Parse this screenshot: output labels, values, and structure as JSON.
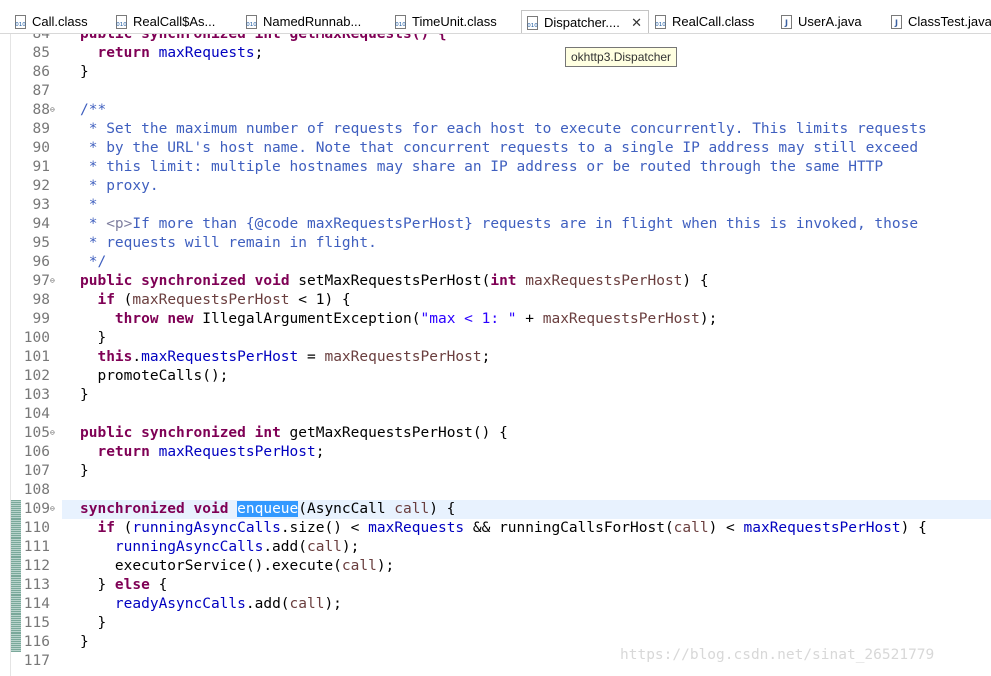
{
  "tabs": [
    {
      "label": "Call.class",
      "icon": "class-file-icon",
      "active": false
    },
    {
      "label": "RealCall$As...",
      "icon": "class-file-icon",
      "active": false
    },
    {
      "label": "NamedRunnab...",
      "icon": "class-file-icon",
      "active": false
    },
    {
      "label": "TimeUnit.class",
      "icon": "class-file-icon",
      "active": false
    },
    {
      "label": "Dispatcher....",
      "icon": "class-file-icon",
      "active": true,
      "close": "✕"
    },
    {
      "label": "RealCall.class",
      "icon": "class-file-icon",
      "active": false
    },
    {
      "label": "UserA.java",
      "icon": "java-file-icon",
      "active": false
    },
    {
      "label": "ClassTest.java",
      "icon": "java-file-icon",
      "active": false
    }
  ],
  "tooltip": "okhttp3.Dispatcher",
  "fold_marker": "⊖",
  "watermark": "https://blog.csdn.net/sinat_26521779",
  "colors": {
    "keyword": "#7f0055",
    "field": "#0000c0",
    "string": "#2a00ff",
    "javadoc": "#3f5fbf",
    "javadoc_tag": "#7f7f9f",
    "local_var": "#6a3e3e",
    "selection": "#3399ff",
    "current_line": "#e8f2fe"
  },
  "code_lines": [
    {
      "n": "84",
      "fold": false,
      "tokens": [
        [
          "public synchronized int getMaxRequests() {",
          "kw"
        ]
      ]
    },
    {
      "n": "85",
      "fold": false,
      "tokens": [
        [
          "  ",
          ""
        ],
        [
          "return",
          "kw"
        ],
        [
          " ",
          ""
        ],
        [
          "maxRequests",
          "fld"
        ],
        [
          ";",
          ""
        ]
      ]
    },
    {
      "n": "86",
      "fold": false,
      "tokens": [
        [
          "}",
          ""
        ]
      ]
    },
    {
      "n": "87",
      "fold": false,
      "tokens": []
    },
    {
      "n": "88",
      "fold": true,
      "tokens": [
        [
          "/**",
          "cmt"
        ]
      ]
    },
    {
      "n": "89",
      "fold": false,
      "tokens": [
        [
          " * Set the maximum number of requests for each host to execute concurrently. This limits requests",
          "cmt"
        ]
      ]
    },
    {
      "n": "90",
      "fold": false,
      "tokens": [
        [
          " * by the URL's host name. Note that concurrent requests to a single IP address may still exceed",
          "cmt"
        ]
      ]
    },
    {
      "n": "91",
      "fold": false,
      "tokens": [
        [
          " * this limit: multiple hostnames may share an IP address or be routed through the same HTTP",
          "cmt"
        ]
      ]
    },
    {
      "n": "92",
      "fold": false,
      "tokens": [
        [
          " * proxy.",
          "cmt"
        ]
      ]
    },
    {
      "n": "93",
      "fold": false,
      "tokens": [
        [
          " *",
          "cmt"
        ]
      ]
    },
    {
      "n": "94",
      "fold": false,
      "tokens": [
        [
          " * ",
          "cmt"
        ],
        [
          "<p>",
          "tag"
        ],
        [
          "If more than {@code maxRequestsPerHost} requests are in flight when this is invoked, those",
          "cmt"
        ]
      ]
    },
    {
      "n": "95",
      "fold": false,
      "tokens": [
        [
          " * requests will remain in flight.",
          "cmt"
        ]
      ]
    },
    {
      "n": "96",
      "fold": false,
      "tokens": [
        [
          " */",
          "cmt"
        ]
      ]
    },
    {
      "n": "97",
      "fold": true,
      "tokens": [
        [
          "public",
          "kw"
        ],
        [
          " ",
          ""
        ],
        [
          "synchronized",
          "kw"
        ],
        [
          " ",
          ""
        ],
        [
          "void",
          "kw"
        ],
        [
          " setMaxRequestsPerHost(",
          ""
        ],
        [
          "int",
          "kw"
        ],
        [
          " ",
          ""
        ],
        [
          "maxRequestsPerHost",
          "var"
        ],
        [
          ") {",
          ""
        ]
      ]
    },
    {
      "n": "98",
      "fold": false,
      "tokens": [
        [
          "  ",
          ""
        ],
        [
          "if",
          "kw"
        ],
        [
          " (",
          ""
        ],
        [
          "maxRequestsPerHost",
          "var"
        ],
        [
          " < 1) {",
          ""
        ]
      ]
    },
    {
      "n": "99",
      "fold": false,
      "tokens": [
        [
          "    ",
          ""
        ],
        [
          "throw",
          "kw"
        ],
        [
          " ",
          ""
        ],
        [
          "new",
          "kw"
        ],
        [
          " IllegalArgumentException(",
          ""
        ],
        [
          "\"max < 1: \"",
          "str"
        ],
        [
          " + ",
          ""
        ],
        [
          "maxRequestsPerHost",
          "var"
        ],
        [
          ");",
          ""
        ]
      ]
    },
    {
      "n": "100",
      "fold": false,
      "tokens": [
        [
          "  }",
          ""
        ]
      ]
    },
    {
      "n": "101",
      "fold": false,
      "tokens": [
        [
          "  ",
          ""
        ],
        [
          "this",
          "kw"
        ],
        [
          ".",
          ""
        ],
        [
          "maxRequestsPerHost",
          "fld"
        ],
        [
          " = ",
          ""
        ],
        [
          "maxRequestsPerHost",
          "var"
        ],
        [
          ";",
          ""
        ]
      ]
    },
    {
      "n": "102",
      "fold": false,
      "tokens": [
        [
          "  promoteCalls();",
          ""
        ]
      ]
    },
    {
      "n": "103",
      "fold": false,
      "tokens": [
        [
          "}",
          ""
        ]
      ]
    },
    {
      "n": "104",
      "fold": false,
      "tokens": []
    },
    {
      "n": "105",
      "fold": true,
      "tokens": [
        [
          "public",
          "kw"
        ],
        [
          " ",
          ""
        ],
        [
          "synchronized",
          "kw"
        ],
        [
          " ",
          ""
        ],
        [
          "int",
          "kw"
        ],
        [
          " getMaxRequestsPerHost() {",
          ""
        ]
      ]
    },
    {
      "n": "106",
      "fold": false,
      "tokens": [
        [
          "  ",
          ""
        ],
        [
          "return",
          "kw"
        ],
        [
          " ",
          ""
        ],
        [
          "maxRequestsPerHost",
          "fld"
        ],
        [
          ";",
          ""
        ]
      ]
    },
    {
      "n": "107",
      "fold": false,
      "tokens": [
        [
          "}",
          ""
        ]
      ]
    },
    {
      "n": "108",
      "fold": false,
      "tokens": []
    },
    {
      "n": "109",
      "fold": true,
      "changed": true,
      "tokens": [
        [
          "synchronized",
          "kw"
        ],
        [
          " ",
          ""
        ],
        [
          "void",
          "kw"
        ],
        [
          " ",
          ""
        ],
        [
          "enqueue",
          "sel"
        ],
        [
          "(AsyncCall ",
          ""
        ],
        [
          "call",
          "var"
        ],
        [
          ") {",
          ""
        ]
      ]
    },
    {
      "n": "110",
      "fold": false,
      "changed": true,
      "tokens": [
        [
          "  ",
          ""
        ],
        [
          "if",
          "kw"
        ],
        [
          " (",
          ""
        ],
        [
          "runningAsyncCalls",
          "fld"
        ],
        [
          ".size() < ",
          ""
        ],
        [
          "maxRequests",
          "fld"
        ],
        [
          " && runningCallsForHost(",
          ""
        ],
        [
          "call",
          "var"
        ],
        [
          ") < ",
          ""
        ],
        [
          "maxRequestsPerHost",
          "fld"
        ],
        [
          ") {",
          ""
        ]
      ]
    },
    {
      "n": "111",
      "fold": false,
      "changed": true,
      "tokens": [
        [
          "    ",
          ""
        ],
        [
          "runningAsyncCalls",
          "fld"
        ],
        [
          ".add(",
          ""
        ],
        [
          "call",
          "var"
        ],
        [
          ");",
          ""
        ]
      ]
    },
    {
      "n": "112",
      "fold": false,
      "changed": true,
      "tokens": [
        [
          "    executorService().execute(",
          ""
        ],
        [
          "call",
          "var"
        ],
        [
          ");",
          ""
        ]
      ]
    },
    {
      "n": "113",
      "fold": false,
      "changed": true,
      "tokens": [
        [
          "  } ",
          ""
        ],
        [
          "else",
          "kw"
        ],
        [
          " {",
          ""
        ]
      ]
    },
    {
      "n": "114",
      "fold": false,
      "changed": true,
      "tokens": [
        [
          "    ",
          ""
        ],
        [
          "readyAsyncCalls",
          "fld"
        ],
        [
          ".add(",
          ""
        ],
        [
          "call",
          "var"
        ],
        [
          ");",
          ""
        ]
      ]
    },
    {
      "n": "115",
      "fold": false,
      "changed": true,
      "tokens": [
        [
          "  }",
          ""
        ]
      ]
    },
    {
      "n": "116",
      "fold": false,
      "changed": true,
      "tokens": [
        [
          "}",
          ""
        ]
      ]
    },
    {
      "n": "117",
      "fold": false,
      "tokens": []
    }
  ]
}
